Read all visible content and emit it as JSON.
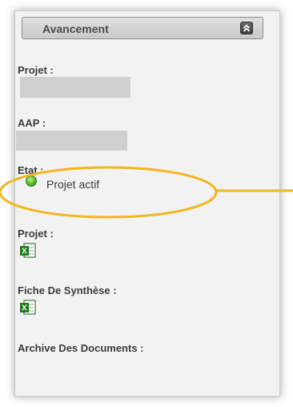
{
  "panel": {
    "title": "Avancement",
    "collapse_icon": "double-chevron-up-icon"
  },
  "fields": {
    "projet_label": "Projet :",
    "aap_label": "AAP :",
    "etat_label": "Etat :",
    "status_text": "Projet actif",
    "status_color": "#52b82b",
    "projet_file_label": "Projet :",
    "fiche_label": "Fiche De Synthèse :",
    "archive_label": "Archive Des Documents :",
    "file_icon": "excel-file-icon"
  },
  "annotation": {
    "color": "#f2b61f"
  }
}
